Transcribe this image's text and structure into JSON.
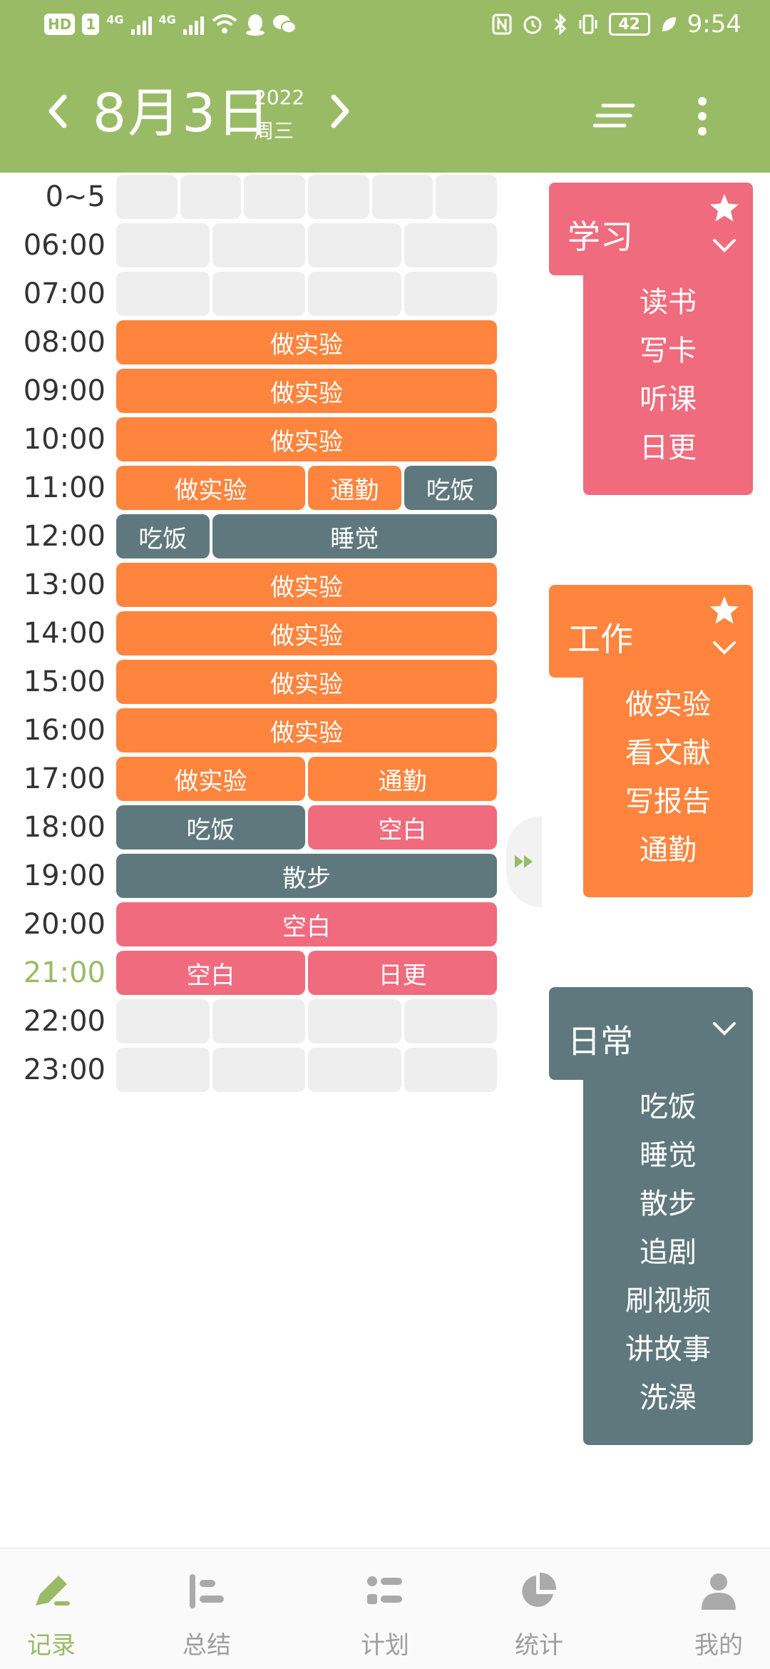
{
  "status_bar": {
    "left_badges": [
      "HD",
      "1"
    ],
    "signal_labels": [
      "4G",
      "4G"
    ],
    "battery": "42",
    "time": "9:54"
  },
  "header": {
    "day": "8月3日",
    "year": "2022",
    "weekday": "周三"
  },
  "timeline": {
    "current_label": "21:00",
    "rows": [
      {
        "label": "0~5",
        "cells": 6,
        "blocks": []
      },
      {
        "label": "06:00",
        "cells": 4,
        "blocks": []
      },
      {
        "label": "07:00",
        "cells": 4,
        "blocks": []
      },
      {
        "label": "08:00",
        "blocks": [
          {
            "text": "做实验",
            "span": 4,
            "cat": "work"
          }
        ]
      },
      {
        "label": "09:00",
        "blocks": [
          {
            "text": "做实验",
            "span": 4,
            "cat": "work"
          }
        ]
      },
      {
        "label": "10:00",
        "blocks": [
          {
            "text": "做实验",
            "span": 4,
            "cat": "work"
          }
        ]
      },
      {
        "label": "11:00",
        "blocks": [
          {
            "text": "做实验",
            "span": 2,
            "cat": "work"
          },
          {
            "text": "通勤",
            "span": 1,
            "cat": "work"
          },
          {
            "text": "吃饭",
            "span": 1,
            "cat": "daily"
          }
        ]
      },
      {
        "label": "12:00",
        "blocks": [
          {
            "text": "吃饭",
            "span": 1,
            "cat": "daily"
          },
          {
            "text": "睡觉",
            "span": 3,
            "cat": "daily"
          }
        ]
      },
      {
        "label": "13:00",
        "blocks": [
          {
            "text": "做实验",
            "span": 4,
            "cat": "work"
          }
        ]
      },
      {
        "label": "14:00",
        "blocks": [
          {
            "text": "做实验",
            "span": 4,
            "cat": "work"
          }
        ]
      },
      {
        "label": "15:00",
        "blocks": [
          {
            "text": "做实验",
            "span": 4,
            "cat": "work"
          }
        ]
      },
      {
        "label": "16:00",
        "blocks": [
          {
            "text": "做实验",
            "span": 4,
            "cat": "work"
          }
        ]
      },
      {
        "label": "17:00",
        "blocks": [
          {
            "text": "做实验",
            "span": 2,
            "cat": "work"
          },
          {
            "text": "通勤",
            "span": 2,
            "cat": "work"
          }
        ]
      },
      {
        "label": "18:00",
        "blocks": [
          {
            "text": "吃饭",
            "span": 2,
            "cat": "daily"
          },
          {
            "text": "空白",
            "span": 2,
            "cat": "study"
          }
        ]
      },
      {
        "label": "19:00",
        "blocks": [
          {
            "text": "散步",
            "span": 4,
            "cat": "daily"
          }
        ]
      },
      {
        "label": "20:00",
        "blocks": [
          {
            "text": "空白",
            "span": 4,
            "cat": "study"
          }
        ]
      },
      {
        "label": "21:00",
        "blocks": [
          {
            "text": "空白",
            "span": 2,
            "cat": "study"
          },
          {
            "text": "日更",
            "span": 2,
            "cat": "study"
          }
        ]
      },
      {
        "label": "22:00",
        "cells": 4,
        "blocks": []
      },
      {
        "label": "23:00",
        "cells": 4,
        "blocks": []
      }
    ]
  },
  "categories": [
    {
      "id": "study",
      "name": "学习",
      "color": "#f06b7d",
      "starred": true,
      "items": [
        "读书",
        "写卡",
        "听课",
        "日更"
      ]
    },
    {
      "id": "work",
      "name": "工作",
      "color": "#ff843d",
      "starred": true,
      "items": [
        "做实验",
        "看文献",
        "写报告",
        "通勤"
      ]
    },
    {
      "id": "daily",
      "name": "日常",
      "color": "#5f787e",
      "starred": false,
      "items": [
        "吃饭",
        "睡觉",
        "散步",
        "追剧",
        "刷视频",
        "讲故事",
        "洗澡"
      ]
    }
  ],
  "colors": {
    "theme": "#99bb66",
    "empty_cell": "#eeeeee",
    "work": "#ff843d",
    "study": "#f06b7d",
    "daily": "#5f787e"
  },
  "bottom_nav": [
    {
      "id": "record",
      "label": "记录",
      "icon": "pencil-icon",
      "active": true
    },
    {
      "id": "summary",
      "label": "总结",
      "icon": "summary-bars-icon",
      "active": false
    },
    {
      "id": "plan",
      "label": "计划",
      "icon": "plan-list-icon",
      "active": false
    },
    {
      "id": "stats",
      "label": "统计",
      "icon": "pie-chart-icon",
      "active": false
    },
    {
      "id": "mine",
      "label": "我的",
      "icon": "user-icon",
      "active": false
    }
  ]
}
